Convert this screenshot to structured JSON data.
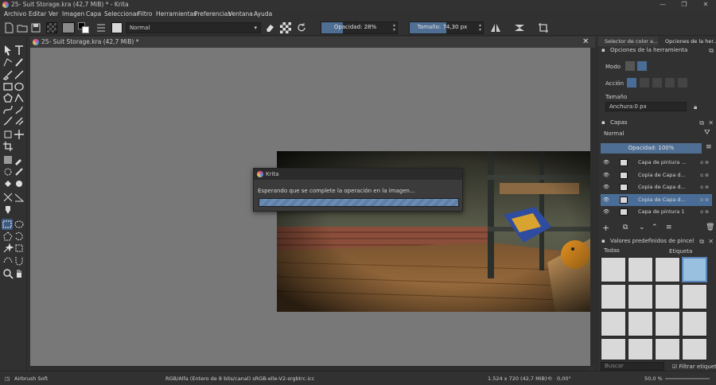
{
  "window": {
    "title": "25- Suit Storage.kra (42,7 MiB) * - Krita",
    "minimize": "—",
    "restore": "❐",
    "close": "✕"
  },
  "menu": [
    "Archivo",
    "Editar",
    "Ver",
    "Imagen",
    "Capa",
    "Seleccionar",
    "Filtro",
    "Herramientas",
    "Preferencias",
    "Ventana",
    "Ayuda"
  ],
  "toolbar": {
    "blend_mode": "Normal",
    "opacity_label": "Opacidad: 28%",
    "opacity_value": 0.28,
    "size_label": "Tamaño: 74,30 px",
    "size_value": 0.5
  },
  "document": {
    "tab_title": "25- Suit Storage.kra (42,7 MiB) *",
    "close": "✕"
  },
  "dialog": {
    "title": "Krita",
    "message": "Esperando que se complete la operación en la imagen...",
    "progress": 1.0
  },
  "dock": {
    "tabs": [
      "Selector de color a...",
      "Opciones de la her..."
    ],
    "tool_options": {
      "title": "Opciones de la herramienta",
      "mode_label": "Modo",
      "action_label": "Acción",
      "size_label": "Tamaño",
      "width_value": "Anchura:0 px"
    },
    "layers": {
      "title": "Capas",
      "blend_mode": "Normal",
      "opacity_label": "Opacidad:  100%",
      "opacity_value": 1.0,
      "items": [
        {
          "name": "Capa de pintura ...",
          "selected": false
        },
        {
          "name": "Copia de Capa d...",
          "selected": false
        },
        {
          "name": "Copia de Capa d...",
          "selected": false
        },
        {
          "name": "Copia de Capa d...",
          "selected": true
        },
        {
          "name": "Capa de pintura 1",
          "selected": false
        }
      ]
    },
    "brushes": {
      "title": "Valores predefinidos de pincel",
      "filter_value": "Todas",
      "tag_label": "Etiqueta",
      "search_placeholder": "Buscar",
      "filter_tag_label": "Filtrar etiqueta"
    }
  },
  "statusbar": {
    "brush": "Airbrush Soft",
    "color_space": "RGB/Alfa (Entero de 8 bits/canal)  sRGB-elle-V2-srgbtrc.icc",
    "dimensions": "1.524 x 720 (42,7 MiB)",
    "rotation": "0,00°",
    "zoom": "50,0 %"
  },
  "colors": {
    "accent": "#4f6e93",
    "selection": "#4a6d97",
    "background": "#313131",
    "canvas": "#787878"
  }
}
